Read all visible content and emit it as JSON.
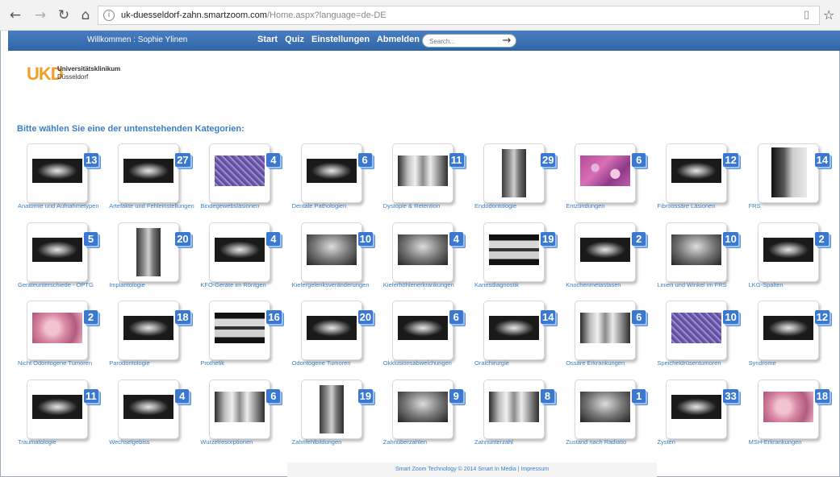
{
  "browser": {
    "back": "←",
    "forward": "→",
    "reload": "↻",
    "home": "⌂",
    "url_host": "uk-duesseldorf-zahn.smartzoom.com",
    "url_path": "/Home.aspx?language=de-DE",
    "icons": [
      "info-icon",
      "reader-view-icon",
      "favorite-star-icon"
    ]
  },
  "topbar": {
    "welcome": "Willkommen : Sophie Ylinen",
    "nav": [
      "Start",
      "Quiz",
      "Einstellungen",
      "Abmelden"
    ],
    "search_placeholder": "Search...",
    "search_arrow": "→"
  },
  "logo": {
    "mark": "UKD",
    "line1": "Universitätsklinikum",
    "line2": "Düsseldorf",
    "color": "#f0a028"
  },
  "heading": "Bitte wählen Sie eine der untenstehenden Kategorien:",
  "accent": "#3c7fc4",
  "badge_color": "#3b78d0",
  "categories": [
    {
      "label": "Anatomie und Aufnahmetypen",
      "count": "13",
      "thumb": "pano"
    },
    {
      "label": "Artefakte und Fehleinstellungen",
      "count": "27",
      "thumb": "pano"
    },
    {
      "label": "Bindegewebsläsionen",
      "count": "4",
      "thumb": "histo-purple"
    },
    {
      "label": "Dentale Pathologien",
      "count": "6",
      "thumb": "pano"
    },
    {
      "label": "Dystopie & Retention",
      "count": "11",
      "thumb": "dental"
    },
    {
      "label": "Endodontologie",
      "count": "29",
      "thumb": "xray-tall"
    },
    {
      "label": "Entzündungen",
      "count": "6",
      "thumb": "histo"
    },
    {
      "label": "Fibroossäre Läsionen",
      "count": "12",
      "thumb": "pano"
    },
    {
      "label": "FRS",
      "count": "14",
      "thumb": "ceph"
    },
    {
      "label": "Geräteunterschiede - OPTG",
      "count": "5",
      "thumb": "pano"
    },
    {
      "label": "Implantologie",
      "count": "20",
      "thumb": "xray-tall"
    },
    {
      "label": "KFO-Geräte im Röntgen",
      "count": "4",
      "thumb": "pano"
    },
    {
      "label": "Kiefergelenksveränderungen",
      "count": "10",
      "thumb": "bw"
    },
    {
      "label": "Kieferhöhlenerkrankungen",
      "count": "4",
      "thumb": "bw"
    },
    {
      "label": "Kariesdiagnostik",
      "count": "19",
      "thumb": "teeth"
    },
    {
      "label": "Knochenmetastasen",
      "count": "2",
      "thumb": "pano"
    },
    {
      "label": "Linien und Winkel im FRS",
      "count": "10",
      "thumb": "bw"
    },
    {
      "label": "LKG-Spalten",
      "count": "2",
      "thumb": "pano"
    },
    {
      "label": "Nicht Odontogene Tumoren",
      "count": "2",
      "thumb": "pink"
    },
    {
      "label": "Parodontologie",
      "count": "18",
      "thumb": "pano"
    },
    {
      "label": "Prothetik",
      "count": "16",
      "thumb": "teeth"
    },
    {
      "label": "Odontogene Tumoren",
      "count": "20",
      "thumb": "pano"
    },
    {
      "label": "Okklusionsabweichungen",
      "count": "6",
      "thumb": "pano"
    },
    {
      "label": "Oralchirurgie",
      "count": "14",
      "thumb": "pano"
    },
    {
      "label": "Ossäre Erkrankungen",
      "count": "6",
      "thumb": "dental"
    },
    {
      "label": "Speicheldrüsentumoren",
      "count": "10",
      "thumb": "histo-purple"
    },
    {
      "label": "Syndrome",
      "count": "12",
      "thumb": "pano"
    },
    {
      "label": "Traumatologie",
      "count": "11",
      "thumb": "pano"
    },
    {
      "label": "Wechselgebiss",
      "count": "4",
      "thumb": "pano"
    },
    {
      "label": "Wurzelresorptionen",
      "count": "6",
      "thumb": "dental"
    },
    {
      "label": "Zahnfehlbildungen",
      "count": "19",
      "thumb": "xray-tall"
    },
    {
      "label": "Zahnüberzahlen",
      "count": "9",
      "thumb": "bw"
    },
    {
      "label": "Zahnunterzahl",
      "count": "8",
      "thumb": "dental"
    },
    {
      "label": "Zustand nach Radiatio",
      "count": "1",
      "thumb": "bw"
    },
    {
      "label": "Zysten",
      "count": "33",
      "thumb": "pano"
    },
    {
      "label": "MSH-Erkrankungen",
      "count": "18",
      "thumb": "pink"
    }
  ],
  "footer": "Smart Zoom Technology © 2014 Smart In Media | Impressum"
}
